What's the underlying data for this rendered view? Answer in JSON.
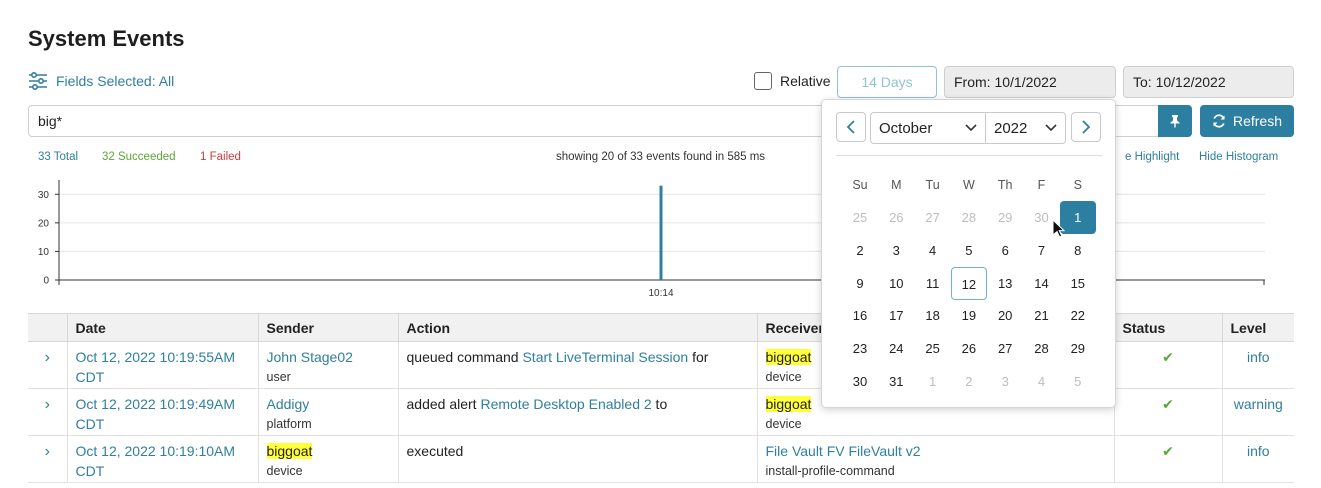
{
  "page": {
    "title": "System Events"
  },
  "toolbar": {
    "fields_label": "Fields Selected: All",
    "relative_label": "Relative",
    "relative_days": "14 Days",
    "from": "From: 10/1/2022",
    "to": "To: 10/12/2022",
    "refresh_label": "Refresh"
  },
  "search": {
    "value": "big*"
  },
  "stats": {
    "total": "33 Total",
    "succeeded": "32 Succeeded",
    "failed": "1 Failed",
    "showing": "showing 20 of 33 events found in 585 ms",
    "highlight_link": "e Highlight",
    "histogram_link": "Hide Histogram"
  },
  "colors": {
    "accent": "#2c7fa0",
    "success": "#5aa834",
    "failed": "#d33b3b",
    "highlight": "#ffff3a"
  },
  "chart_data": {
    "type": "bar",
    "yticks": [
      "0",
      "10",
      "20",
      "30"
    ],
    "ylim": [
      0,
      35
    ],
    "x_label": "10:14",
    "bars": [
      {
        "label": "10:14",
        "value": 33
      }
    ],
    "grid": true
  },
  "table": {
    "columns": [
      "Date",
      "Sender",
      "Action",
      "Receiver",
      "Status",
      "Level"
    ],
    "rows": [
      {
        "date_line1": "Oct 12, 2022 10:19:55AM",
        "date_line2": "CDT",
        "sender": "John Stage02",
        "sender_type": "user",
        "action_pre": "queued command ",
        "action_link": "Start LiveTerminal Session",
        "action_post": " for",
        "receiver": "biggoat",
        "receiver_type": "device",
        "status": "✔",
        "level": "info"
      },
      {
        "date_line1": "Oct 12, 2022 10:19:49AM",
        "date_line2": "CDT",
        "sender": "Addigy",
        "sender_type": "platform",
        "action_pre": "added alert ",
        "action_link": "Remote Desktop Enabled 2",
        "action_post": " to",
        "receiver": "biggoat",
        "receiver_type": "device",
        "status": "✔",
        "level": "warning"
      },
      {
        "date_line1": "Oct 12, 2022 10:19:10AM",
        "date_line2": "CDT",
        "sender": "biggoat",
        "sender_type": "device",
        "action_pre": "executed",
        "action_link": "",
        "action_post": "",
        "receiver": "File Vault FV FileVault v2",
        "receiver_type": "install-profile-command",
        "status": "✔",
        "level": "info"
      }
    ]
  },
  "calendar": {
    "month": "October",
    "year": "2022",
    "weekdays": [
      "Su",
      "M",
      "Tu",
      "W",
      "Th",
      "F",
      "S"
    ],
    "weeks": [
      [
        "25",
        "26",
        "27",
        "28",
        "29",
        "30",
        "1"
      ],
      [
        "2",
        "3",
        "4",
        "5",
        "6",
        "7",
        "8"
      ],
      [
        "9",
        "10",
        "11",
        "12",
        "13",
        "14",
        "15"
      ],
      [
        "16",
        "17",
        "18",
        "19",
        "20",
        "21",
        "22"
      ],
      [
        "23",
        "24",
        "25",
        "26",
        "27",
        "28",
        "29"
      ],
      [
        "30",
        "31",
        "1",
        "2",
        "3",
        "4",
        "5"
      ]
    ],
    "selected_day": "1",
    "today_day": "12"
  }
}
